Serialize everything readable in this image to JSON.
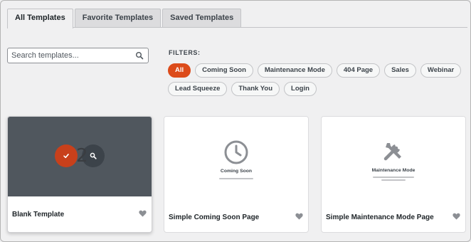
{
  "tabs": [
    {
      "label": "All Templates",
      "active": true
    },
    {
      "label": "Favorite Templates",
      "active": false
    },
    {
      "label": "Saved Templates",
      "active": false
    }
  ],
  "search": {
    "placeholder": "Search templates..."
  },
  "filters": {
    "label": "FILTERS:",
    "chips": [
      {
        "label": "All",
        "active": true
      },
      {
        "label": "Coming Soon"
      },
      {
        "label": "Maintenance Mode"
      },
      {
        "label": "404 Page"
      },
      {
        "label": "Sales"
      },
      {
        "label": "Webinar"
      },
      {
        "label": "Lead Squeeze"
      },
      {
        "label": "Thank You"
      },
      {
        "label": "Login"
      }
    ]
  },
  "templates": [
    {
      "title": "Blank Template",
      "thumb": "dark-placeholder",
      "actions": [
        "check-icon",
        "search-icon"
      ]
    },
    {
      "title": "Simple Coming Soon Page",
      "thumb_title": "Coming Soon",
      "thumb_icon": "clock-icon"
    },
    {
      "title": "Simple Maintenance Mode Page",
      "thumb_title": "Maintenance Mode",
      "thumb_icon": "tools-icon"
    }
  ],
  "colors": {
    "accent": "#dc4b1a",
    "check_button": "#c8401b",
    "blank_thumb": "#50575e"
  }
}
